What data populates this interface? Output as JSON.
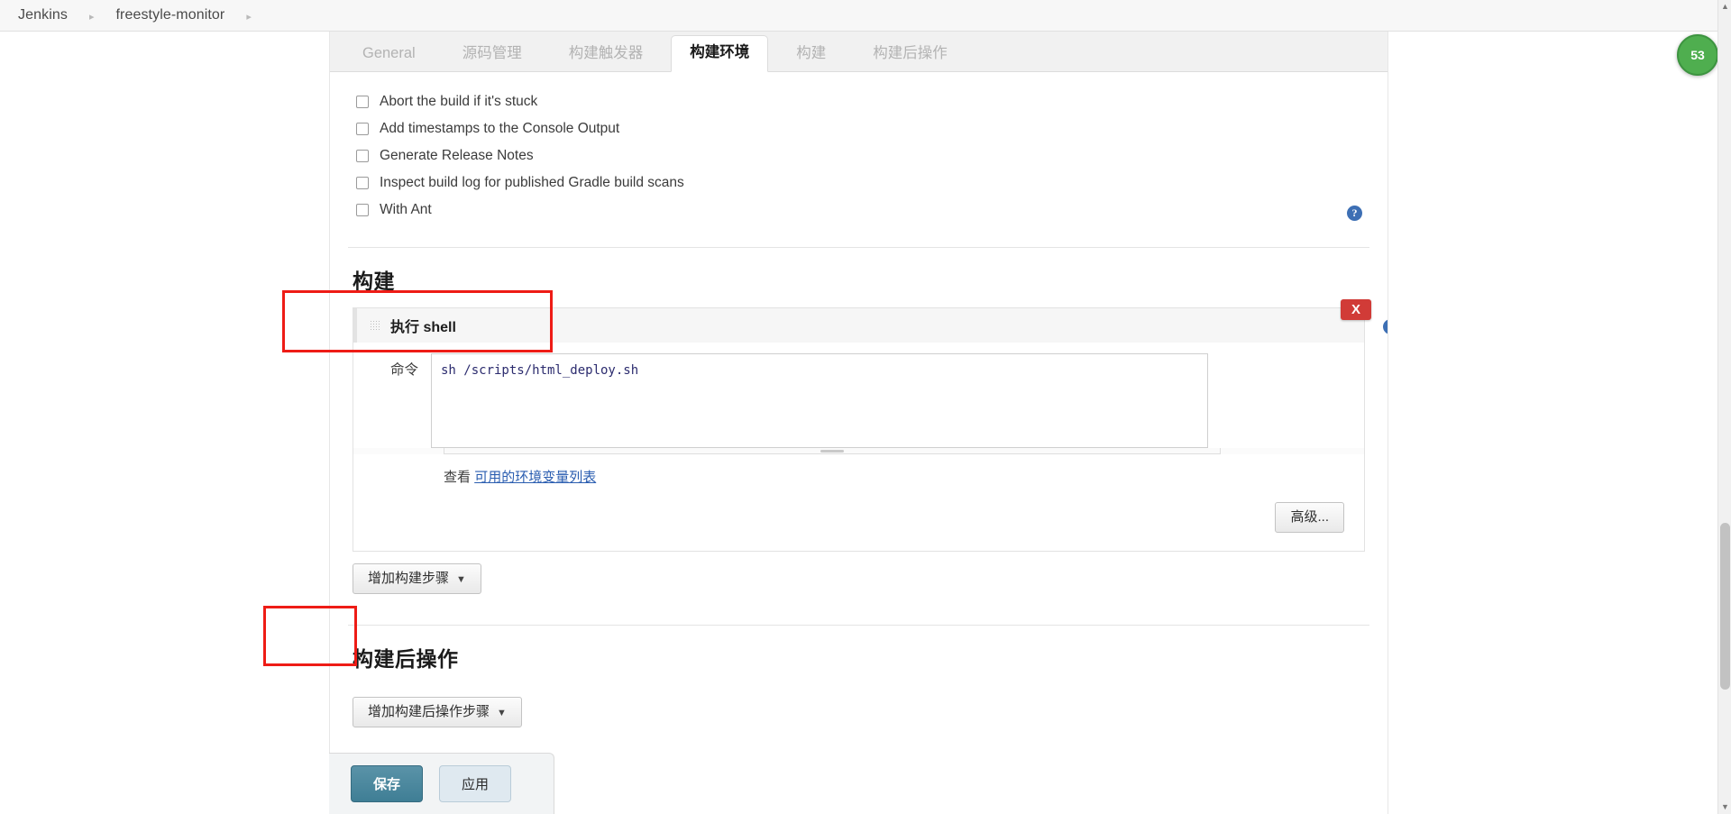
{
  "breadcrumb": {
    "items": [
      {
        "label": "Jenkins"
      },
      {
        "label": "freestyle-monitor"
      }
    ],
    "separator": "▸"
  },
  "tabs": [
    {
      "label": "General",
      "active": false
    },
    {
      "label": "源码管理",
      "active": false
    },
    {
      "label": "构建触发器",
      "active": false
    },
    {
      "label": "构建环境",
      "active": true
    },
    {
      "label": "构建",
      "active": false
    },
    {
      "label": "构建后操作",
      "active": false
    }
  ],
  "build_environment": {
    "checkboxes": [
      {
        "label": "Abort the build if it's stuck",
        "checked": false
      },
      {
        "label": "Add timestamps to the Console Output",
        "checked": false
      },
      {
        "label": "Generate Release Notes",
        "checked": false
      },
      {
        "label": "Inspect build log for published Gradle build scans",
        "checked": false
      },
      {
        "label": "With Ant",
        "checked": false
      }
    ],
    "help_icon": "help-icon",
    "help_glyph": "?"
  },
  "build_section": {
    "title": "构建",
    "builder": {
      "name": "执行 shell",
      "delete_label": "X",
      "grip_icon": "drag-handle-icon",
      "help_glyph": "?",
      "command_label": "命令",
      "command_value": "sh /scripts/html_deploy.sh",
      "command_placeholder": "",
      "envvar_prefix": "查看",
      "envvar_link": "可用的环境变量列表",
      "advanced_label": "高级..."
    },
    "add_step_label": "增加构建步骤",
    "caret": "▼"
  },
  "post_build_section": {
    "title": "构建后操作",
    "add_step_label": "增加构建后操作步骤",
    "caret": "▼"
  },
  "action_bar": {
    "save_label": "保存",
    "apply_label": "应用"
  },
  "floating_badge": {
    "label": "53"
  },
  "scrollbar": {
    "up_arrow": "▲",
    "down_arrow": "▼"
  },
  "colors": {
    "accent_blue": "#3d6fb4",
    "save_teal": "#3f7e95",
    "delete_red": "#d13b37",
    "annotation_red": "#ee1c16",
    "badge_green": "#4fae4f",
    "link_blue": "#2a5db0"
  }
}
